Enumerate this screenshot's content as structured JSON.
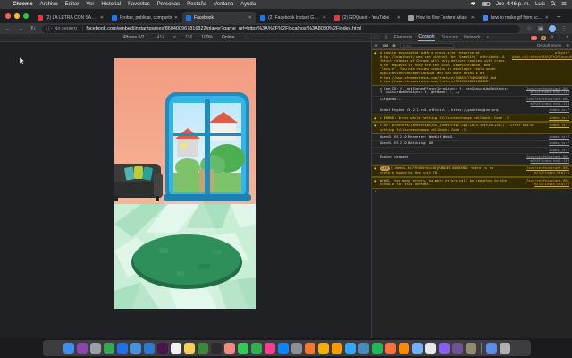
{
  "menubar": {
    "items": [
      "Chrome",
      "Archivo",
      "Editar",
      "Ver",
      "Historial",
      "Favoritos",
      "Personas",
      "Pestaña",
      "Ventana",
      "Ayuda"
    ],
    "clock": "Jue 4:46 p. m.",
    "user": "Luis"
  },
  "tabs": [
    {
      "label": "(2) LA LETRA CON SANGRE",
      "color": "#e53935",
      "active": false
    },
    {
      "label": "Probar, publicar, compartir",
      "color": "#1877f2",
      "active": false
    },
    {
      "label": "Facebook",
      "color": "#1877f2",
      "active": true
    },
    {
      "label": "(2) Facebook Instant Games",
      "color": "#1877f2",
      "active": false
    },
    {
      "label": "(2) GDQuest - YouTube",
      "color": "#e53935",
      "active": false
    },
    {
      "label": "How to Use Texture Atlas",
      "color": "#9e9e9e",
      "active": false
    },
    {
      "label": "how to make gif from screen",
      "color": "#4285f4",
      "active": false
    }
  ],
  "omnibox": {
    "security": "No seguro",
    "url": "facebook.com/embed/instantgames/860400967816822/player?game_url=https%3A%2F%2Flocalhost%3A8080%2Findex.html"
  },
  "device_toolbar": {
    "device": "iPhone 6/7...",
    "width": "414",
    "height": "736",
    "zoom": "100%",
    "network": "Online"
  },
  "devtools": {
    "tabs": [
      "Elements",
      "Console",
      "Sources",
      "Network"
    ],
    "active_tab": "Console",
    "more": "»",
    "error_count": "2",
    "warning_count": "4",
    "context": "top",
    "filter_placeholder": "Filter",
    "levels": "Default levels",
    "messages": [
      {
        "type": "warn",
        "text": "A cookie associated with a cross-site resource at http://localhost/ was set without the `SameSite` attribute. A future release of Chrome will only deliver cookies with cross-site requests if they are set with `SameSite=None` and `Secure`. You can review cookies in developer tools under Application>Storage>Cookies and see more details at https://www.chromestatus.com/feature/5088147346030592 and https://www.chromestatus.com/feature/5633521622188032.",
        "src": "player?game_url=https%3A%2F%2Flocalhost%3A8080%2Findex.html:1"
      },
      {
        "type": "log",
        "text": "▸ {getID: f, getSignedPlayerInfoAsync: f, canSubscribeBotAsync: f, subscribeBotAsync: f, getName: f, …}",
        "src": "?source=fbinstant-86…ml%2Findex.html:113"
      },
      {
        "type": "log",
        "text": "Cargando...",
        "src": "?source=fbinstant-86…ml%2Findex.html:113"
      },
      {
        "type": "log",
        "text": "Godot Engine v3.2.1.rc1.official - https://godotengine.org",
        "src": "index.js:7"
      },
      {
        "type": "warn",
        "text": "▸ ERROR: Error while setting fullscreenchange callback: Code -1",
        "src": "index.js:7"
      },
      {
        "type": "warn",
        "text": "▸   At: platform/javascript/os_javascript.cpp:1023:initialize() - Error while setting fullscreenchange callback: Code -1",
        "src": "index.js:7"
      },
      {
        "type": "log",
        "text": "OpenGL ES 2.0 Renderer: WebKit WebGL",
        "src": "index.js:7"
      },
      {
        "type": "log",
        "text": "OpenGL ES 2.0 Batching: ON",
        "src": "index.js:7"
      },
      {
        "type": "log",
        "text": "",
        "src": "index.js:7"
      },
      {
        "type": "log",
        "text": "Engine cargado",
        "src": "?source=fbinstant-86…ml%2Findex.html:119"
      },
      {
        "type": "warn",
        "count": "216",
        "text": "[.WebGL-0x7f93d595cc00]RENDER WARNING: there is no texture bound to the unit 78",
        "src": "?source=fbinstant-86…ml%2Findex.html:1"
      },
      {
        "type": "warn",
        "text": "WebGL: too many errors, no more errors will be reported to the console for this context.",
        "src": "?source=fbinstant-86…ml%2Findex.html:1"
      }
    ],
    "prompt": "›"
  },
  "colors": {
    "wall": "#f19a7f",
    "floor_light": "#d9f3e2",
    "floor_dark": "#a9e0bf",
    "rug": "#2f8f5a",
    "window_frame": "#2ba6d6",
    "sofa": "#3b3b3b"
  },
  "dock": {
    "icons": [
      {
        "name": "finder-icon",
        "color": "#3d8ef0"
      },
      {
        "name": "siri-icon",
        "color": "#8e44ad"
      },
      {
        "name": "launchpad-icon",
        "color": "#9aa0a6"
      },
      {
        "name": "chrome-icon",
        "color": "#34a853"
      },
      {
        "name": "safari-icon",
        "color": "#1a73e8"
      },
      {
        "name": "mail-icon",
        "color": "#4a90e2"
      },
      {
        "name": "vscode-icon",
        "color": "#2a7ad1"
      },
      {
        "name": "slack-icon",
        "color": "#4a154b"
      },
      {
        "name": "calendar-icon",
        "color": "#f1f1f1"
      },
      {
        "name": "notes-icon",
        "color": "#f7d154"
      },
      {
        "name": "nodejs-icon",
        "color": "#3c873a"
      },
      {
        "name": "terminal-icon",
        "color": "#2b2b2b"
      },
      {
        "name": "photos-icon",
        "color": "#f28b82"
      },
      {
        "name": "messages-icon",
        "color": "#34c759"
      },
      {
        "name": "facetime-icon",
        "color": "#30b04a"
      },
      {
        "name": "itunes-icon",
        "color": "#fc3c8d"
      },
      {
        "name": "appstore-icon",
        "color": "#0a84ff"
      },
      {
        "name": "preferences-icon",
        "color": "#8e8e93"
      },
      {
        "name": "blender-icon",
        "color": "#f5792a"
      },
      {
        "name": "sketch-icon",
        "color": "#fdad00"
      },
      {
        "name": "illustrator-icon",
        "color": "#ff9a00"
      },
      {
        "name": "photoshop-icon",
        "color": "#31a8ff"
      },
      {
        "name": "godot-icon",
        "color": "#478cbf"
      },
      {
        "name": "spotify-icon",
        "color": "#1db954"
      },
      {
        "name": "firefox-icon",
        "color": "#ff7139"
      },
      {
        "name": "vlc-icon",
        "color": "#ff8800"
      },
      {
        "name": "preview-icon",
        "color": "#6fb1fc"
      },
      {
        "name": "textedit-icon",
        "color": "#e8e8e8"
      },
      {
        "name": "vectornator-icon",
        "color": "#8a5cf6"
      },
      {
        "name": "github-icon",
        "color": "#6e5494"
      },
      {
        "name": "gimp-icon",
        "color": "#8f8b70"
      },
      {
        "name": "downloads-icon",
        "color": "#5b8def"
      },
      {
        "name": "trash-icon",
        "color": "#b0b0b0"
      }
    ]
  }
}
